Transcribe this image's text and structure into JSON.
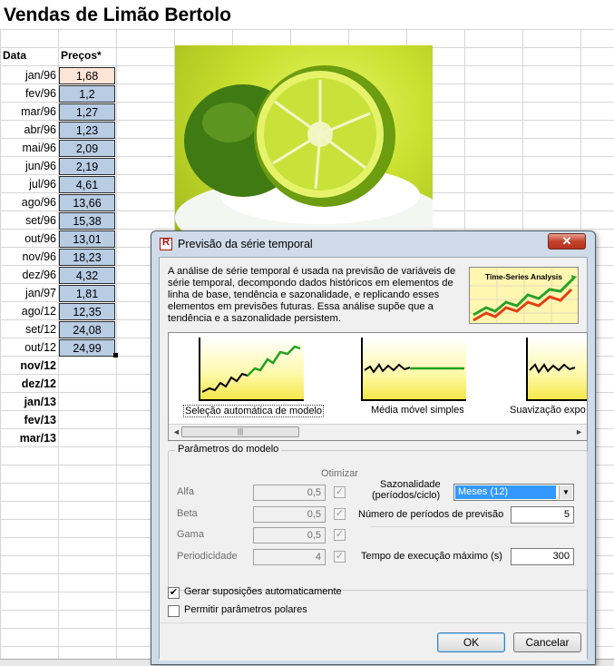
{
  "sheet": {
    "title": "Vendas de Limão Bertolo",
    "col_date_header": "Data",
    "col_price_header": "Preços*",
    "rows": [
      {
        "date": "jan/96",
        "price": "1,68"
      },
      {
        "date": "fev/96",
        "price": "1,2"
      },
      {
        "date": "mar/96",
        "price": "1,27"
      },
      {
        "date": "abr/96",
        "price": "1,23"
      },
      {
        "date": "mai/96",
        "price": "2,09"
      },
      {
        "date": "jun/96",
        "price": "2,19"
      },
      {
        "date": "jul/96",
        "price": "4,61"
      },
      {
        "date": "ago/96",
        "price": "13,66"
      },
      {
        "date": "set/96",
        "price": "15,38"
      },
      {
        "date": "out/96",
        "price": "13,01"
      },
      {
        "date": "nov/96",
        "price": "18,23"
      },
      {
        "date": "dez/96",
        "price": "4,32"
      },
      {
        "date": "jan/97",
        "price": "1,81"
      },
      {
        "date": "ago/12",
        "price": "12,35"
      },
      {
        "date": "set/12",
        "price": "24,08"
      },
      {
        "date": "out/12",
        "price": "24,99"
      }
    ],
    "forecast_dates": [
      "nov/12",
      "dez/12",
      "jan/13",
      "fev/13",
      "mar/13"
    ]
  },
  "dialog": {
    "title": "Previsão da série temporal",
    "close_label": "✕",
    "description": "A análise de série temporal é usada na previsão de variáveis de série temporal, decompondo dados históricos em elementos de linha de base, tendência e sazonalidade, e replicando esses elementos em previsões futuras. Essa análise supõe que a tendência e a sazonalidade persistem.",
    "thumb_caption": "Time-Series Analysis",
    "methods": [
      {
        "label": "Seleção automática de modelo",
        "selected": true
      },
      {
        "label": "Média móvel simples",
        "selected": false
      },
      {
        "label": "Suavização expo",
        "selected": false
      }
    ],
    "scroll_left": "◄",
    "scroll_right": "►",
    "scroll_grip": "|||",
    "params_group_label": "Parâmetros do modelo",
    "optimize_label": "Otimizar",
    "params": [
      {
        "label": "Alfa",
        "value": "0,5",
        "check": "✓"
      },
      {
        "label": "Beta",
        "value": "0,5",
        "check": "✓"
      },
      {
        "label": "Gama",
        "value": "0,5",
        "check": "✓"
      },
      {
        "label": "Periodicidade",
        "value": "4",
        "check": "✓"
      }
    ],
    "seasonality_label": "Sazonalidade",
    "seasonality_sub": "(períodos/ciclo)",
    "seasonality_value": "Meses (12)",
    "forecast_periods_label": "Número de períodos de previsão",
    "forecast_periods_value": "5",
    "max_time_label": "Tempo de execução máximo (s)",
    "max_time_value": "300",
    "auto_assumptions_label": "Gerar suposições automaticamente",
    "auto_assumptions_checked": "✔",
    "polar_label": "Permitir parâmetros polares",
    "ok_label": "OK",
    "cancel_label": "Cancelar"
  }
}
